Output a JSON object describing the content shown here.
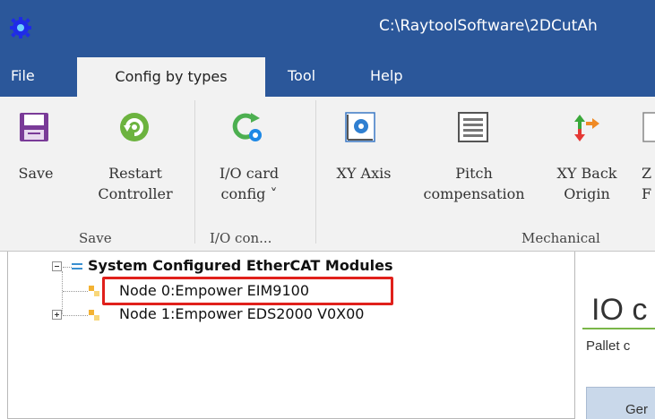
{
  "window": {
    "title": "C:\\RaytoolSoftware\\2DCutAh",
    "app_icon": "gear-icon",
    "accent_color": "#2b579a"
  },
  "menu": {
    "tabs": [
      {
        "label": "File",
        "active": false
      },
      {
        "label": "Config by types",
        "active": true
      },
      {
        "label": "Tool",
        "active": false
      },
      {
        "label": "Help",
        "active": false
      }
    ]
  },
  "ribbon": {
    "buttons": {
      "save": {
        "line1": "Save",
        "line2": "",
        "icon": "floppy-disk-icon"
      },
      "restart": {
        "line1": "Restart",
        "line2": "Controller",
        "icon": "restart-icon"
      },
      "io_card": {
        "line1": "I/O card",
        "line2": "config ˅",
        "icon": "io-config-icon"
      },
      "xy_axis": {
        "line1": "XY Axis",
        "line2": "",
        "icon": "gear-axis-icon"
      },
      "pitch": {
        "line1": "Pitch",
        "line2": "compensation",
        "icon": "pitch-compensation-icon"
      },
      "xy_back": {
        "line1": "XY Back",
        "line2": "Origin",
        "icon": "back-origin-icon"
      },
      "cutoff": {
        "line1": "Z",
        "line2": "F",
        "icon": "z-icon"
      }
    },
    "groups": {
      "save": "Save",
      "io": "I/O con...",
      "mechanical": "Mechanical"
    }
  },
  "tree": {
    "root": "System Configured EtherCAT Modules",
    "nodes": [
      {
        "label": "Node 0:Empower EIM9100",
        "highlighted": true
      },
      {
        "label": "Node 1:Empower EDS2000 V0X00",
        "highlighted": false
      }
    ],
    "highlight_color": "#e0201b"
  },
  "right_panel": {
    "title": "IO c",
    "subtitle": "Pallet c",
    "button": "Ger"
  }
}
